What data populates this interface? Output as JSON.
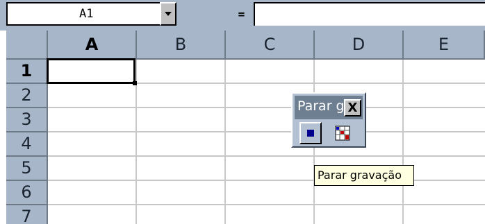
{
  "formula_bar": {
    "name_box_value": "A1",
    "equals_label": "=",
    "formula_value": ""
  },
  "sheet": {
    "active_cell": "A1",
    "columns": [
      "A",
      "B",
      "C",
      "D",
      "E"
    ],
    "rows": [
      "1",
      "2",
      "3",
      "4",
      "5",
      "6",
      "7"
    ]
  },
  "toolbar": {
    "title": "Parar g",
    "close_label": "X",
    "buttons": [
      {
        "icon": "stop-recording-icon"
      },
      {
        "icon": "relative-reference-icon"
      }
    ]
  },
  "tooltip": {
    "text": "Parar gravação"
  },
  "colors": {
    "header": "#a7b6c8",
    "toolbar_title": "#6f7f92",
    "stop_icon": "#00008b",
    "tooltip": "#ffffe1"
  }
}
